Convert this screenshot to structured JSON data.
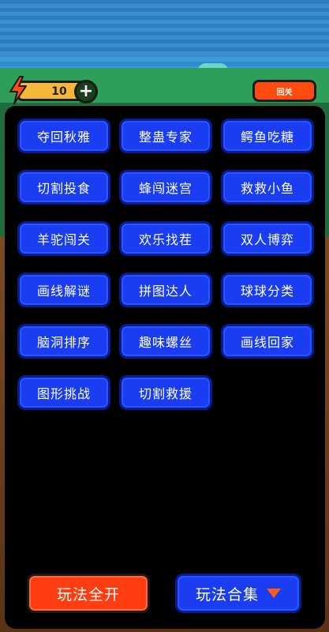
{
  "energy": {
    "value": "10"
  },
  "top_right_button": {
    "label": "回关"
  },
  "games": [
    "夺回秋雅",
    "整蛊专家",
    "鳄鱼吃糖",
    "切割投食",
    "蜂闯迷宫",
    "救救小鱼",
    "羊驼闯关",
    "欢乐找茬",
    "双人博弈",
    "画线解谜",
    "拼图达人",
    "球球分类",
    "脑洞排序",
    "趣味螺丝",
    "画线回家",
    "图形挑战",
    "切割救援"
  ],
  "bottom": {
    "all_label": "玩法全开",
    "collection_label": "玩法合集"
  },
  "colors": {
    "button_blue": "#1a3df2",
    "button_red": "#ff3d10",
    "panel": "#000000",
    "energy": "#f4b73a"
  }
}
